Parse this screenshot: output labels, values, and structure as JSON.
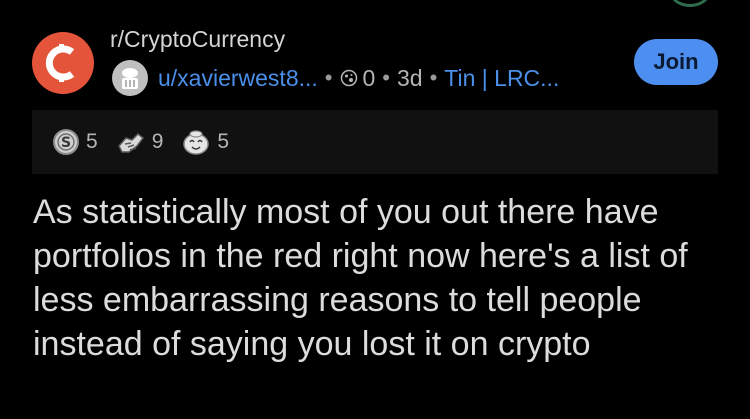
{
  "post": {
    "subreddit": "r/CryptoCurrency",
    "username": "u/xavierwest8...",
    "moons": "0",
    "age": "3d",
    "flair": "Tin | LRC...",
    "join_label": "Join",
    "title": "As statistically most of you out there have portfolios in the red right now here's a list of less embarrassing reasons to tell people instead of saying you lost it on crypto"
  },
  "awards": [
    {
      "icon": "silver-award-icon",
      "count": "5"
    },
    {
      "icon": "helpful-award-icon",
      "count": "9"
    },
    {
      "icon": "wholesome-award-icon",
      "count": "5"
    }
  ],
  "colors": {
    "background": "#000000",
    "accent": "#4a8fe8",
    "join_button": "#4c8ff0",
    "subreddit_icon": "#e4543a"
  }
}
